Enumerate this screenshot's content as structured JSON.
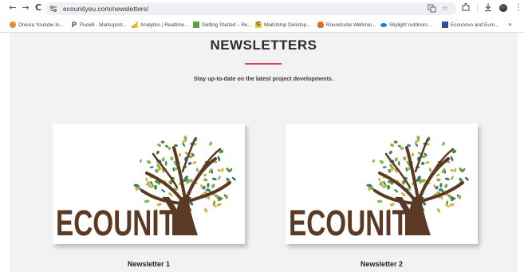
{
  "browser": {
    "url": "ecounityeu.com/newsletters/",
    "nav": {
      "back": "←",
      "forward": "→",
      "reload": "C"
    },
    "bookmarks": [
      {
        "label": "Onesia Youtube In...",
        "icon": "orange-circle-icon",
        "color": "#e8872b"
      },
      {
        "label": "Pucelli - Markupost...",
        "icon": "p-logo-icon",
        "color": "#333333"
      },
      {
        "label": "Analytics | Realtime...",
        "icon": "analytics-icon",
        "color": "#f4a21a"
      },
      {
        "label": "Getting Started – Re...",
        "icon": "green-square-icon",
        "color": "#5aa33a"
      },
      {
        "label": "Mailchimp Desktop...",
        "icon": "mailchimp-icon",
        "color": "#f2c230"
      },
      {
        "label": "Roundcube Webmai...",
        "icon": "roundcube-icon",
        "color": "#e46b21"
      },
      {
        "label": "Skylight outdoors...",
        "icon": "skylight-icon",
        "color": "#2a7cc7"
      },
      {
        "label": "Ecounovo and Euro...",
        "icon": "blue-square-icon",
        "color": "#2d4f9c"
      }
    ],
    "more_label": "»"
  },
  "page": {
    "title": "NEWSLETTERS",
    "subtitle": "Stay up-to-date on the latest project developments.",
    "accent_color": "#d9434f",
    "cards": [
      {
        "label": "Newsletter 1",
        "logo_text": "ECOUNIT"
      },
      {
        "label": "Newsletter 2",
        "logo_text": "ECOUNIT"
      }
    ]
  },
  "colors": {
    "logo_brown": "#5a3a24",
    "leaf_greens": [
      "#8fb04a",
      "#4f8a3c",
      "#c9b34a",
      "#3f7a6e"
    ]
  }
}
